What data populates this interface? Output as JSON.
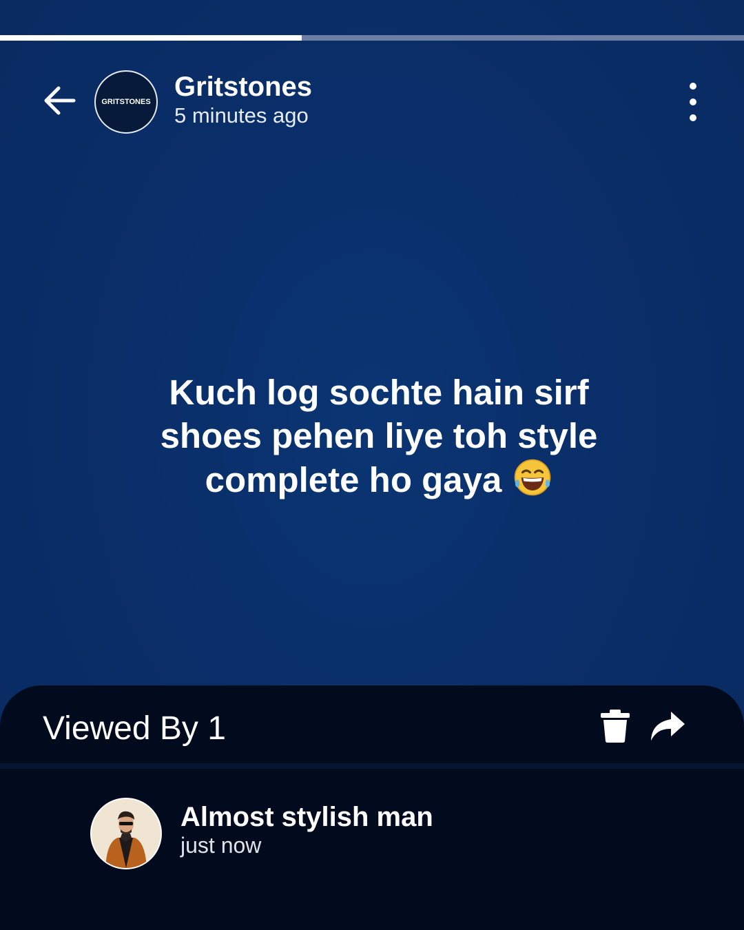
{
  "story": {
    "progress_fraction": 0.406,
    "author_name": "Gritstones",
    "posted_time": "5 minutes ago",
    "avatar_logo_text": "GRITSTONES",
    "text_lines": [
      "Kuch log sochte hain sirf",
      "shoes pehen liye toh style",
      "complete ho gaya"
    ],
    "emoji": "face-with-tears-of-joy"
  },
  "viewers_sheet": {
    "heading": "Viewed By 1",
    "viewers": [
      {
        "name": "Almost stylish man",
        "time": "just now"
      }
    ]
  },
  "icons": {
    "back": "back-arrow-icon",
    "menu": "more-vertical-icon",
    "delete": "trash-icon",
    "share": "share-forward-icon"
  },
  "colors": {
    "background": "#0a2e69",
    "sheet": "#020a1d",
    "progress_track": "#6c7ea3",
    "progress_fill": "#ffffff",
    "text": "#ffffff"
  }
}
